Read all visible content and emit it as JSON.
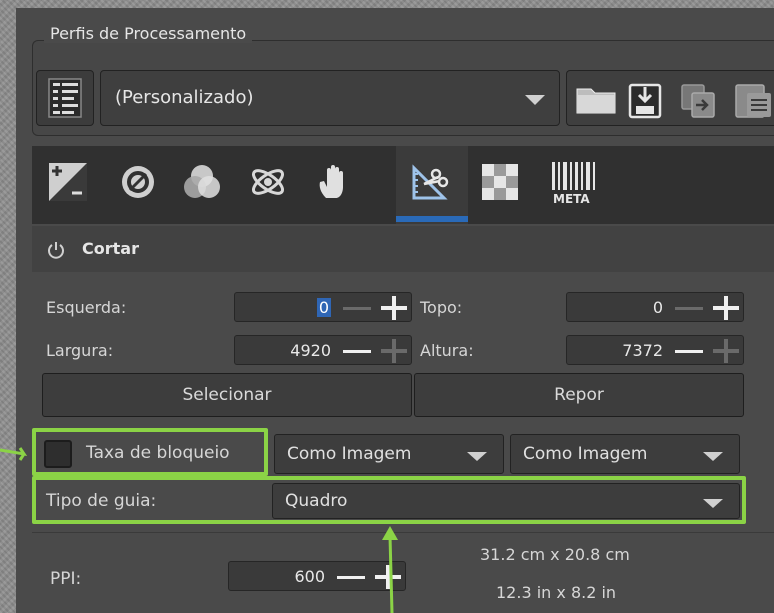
{
  "profiles": {
    "group_title": "Perfis de Processamento",
    "selected_profile": "(Personalizado)"
  },
  "tools": {
    "tabs": [
      "exposure",
      "detail",
      "color",
      "advanced",
      "local-adjustments",
      "transform",
      "raw",
      "metadata"
    ],
    "active_tab": "transform",
    "meta_label": "META"
  },
  "crop": {
    "section_title": "Cortar",
    "left_label": "Esquerda:",
    "left_value": "0",
    "top_label": "Topo:",
    "top_value": "0",
    "width_label": "Largura:",
    "width_value": "4920",
    "height_label": "Altura:",
    "height_value": "7372",
    "select_button": "Selecionar",
    "reset_button": "Repor",
    "lock_ratio_label": "Taxa de bloqueio",
    "ratio_combo_1": "Como Imagem",
    "ratio_combo_2": "Como Imagem",
    "guide_label": "Tipo de guia:",
    "guide_value": "Quadro",
    "ppi_label": "PPI:",
    "ppi_value": "600",
    "size_cm": "31.2 cm x 20.8 cm",
    "size_in": "12.3 in x 8.2 in"
  },
  "colors": {
    "accent": "#2a6ab8",
    "highlight": "#8bd346"
  }
}
